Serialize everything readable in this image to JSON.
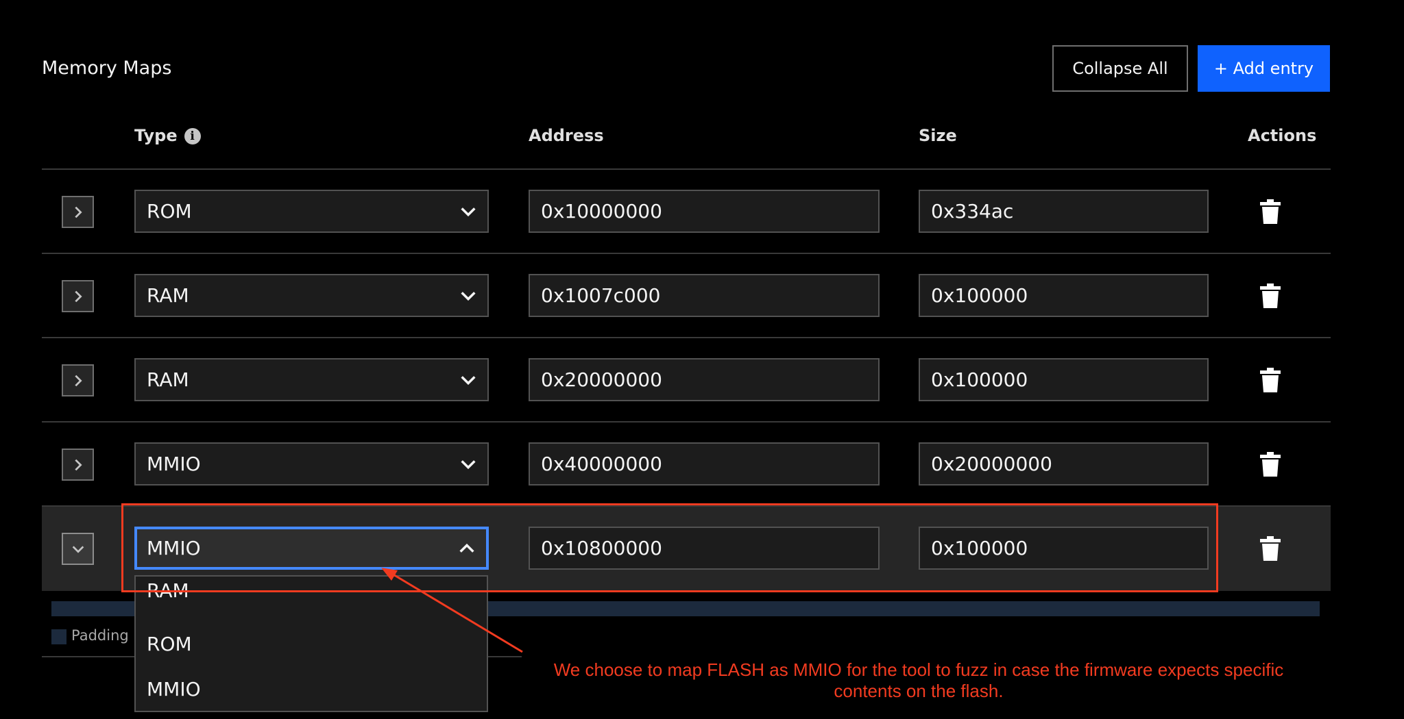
{
  "header": {
    "title": "Memory Maps",
    "collapse_all_label": "Collapse All",
    "add_entry_label": "+ Add entry"
  },
  "table": {
    "columns": {
      "type": "Type",
      "address": "Address",
      "size": "Size",
      "actions": "Actions"
    },
    "rows": [
      {
        "type": "ROM",
        "address": "0x10000000",
        "size": "0x334ac",
        "expanded": false
      },
      {
        "type": "RAM",
        "address": "0x1007c000",
        "size": "0x100000",
        "expanded": false
      },
      {
        "type": "RAM",
        "address": "0x20000000",
        "size": "0x100000",
        "expanded": false
      },
      {
        "type": "MMIO",
        "address": "0x40000000",
        "size": "0x20000000",
        "expanded": false
      },
      {
        "type": "MMIO",
        "address": "0x10800000",
        "size": "0x100000",
        "expanded": true
      }
    ]
  },
  "dropdown": {
    "options": [
      "RAM",
      "ROM",
      "MMIO"
    ]
  },
  "padding_legend": {
    "label": "Padding"
  },
  "annotation": {
    "text": "We choose to map FLASH as MMIO for the tool to fuzz in case the firmware expects specific contents on the flash.",
    "color": "#f23b20"
  },
  "colors": {
    "accent": "#0f62fe",
    "focus": "#4589ff",
    "background": "#000000"
  }
}
